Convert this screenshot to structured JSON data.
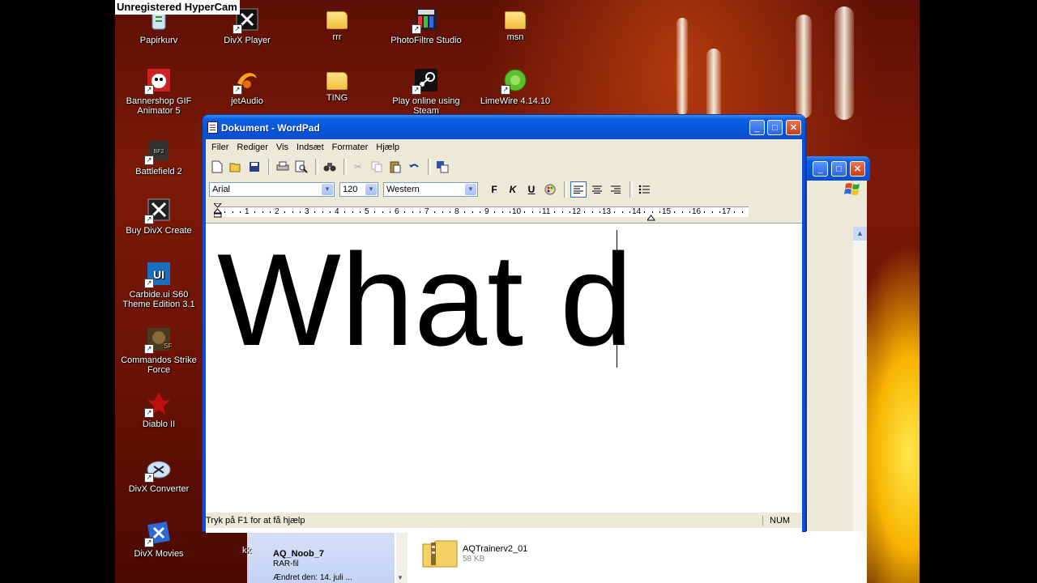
{
  "recorder_banner": "Unregistered HyperCam",
  "desktop": {
    "icons": [
      {
        "label": "Papirkurv",
        "icon": "recycle-bin-icon"
      },
      {
        "label": "DivX Player",
        "icon": "divx-player-icon"
      },
      {
        "label": "rrr",
        "icon": "folder-icon"
      },
      {
        "label": "PhotoFiltre Studio",
        "icon": "photofiltre-icon"
      },
      {
        "label": "msn",
        "icon": "folder-icon"
      },
      {
        "label": "Bannershop GIF Animator 5",
        "icon": "bannershop-icon"
      },
      {
        "label": "jetAudio",
        "icon": "jetaudio-icon"
      },
      {
        "label": "TING",
        "icon": "folder-icon"
      },
      {
        "label": "Play online using Steam",
        "icon": "steam-icon"
      },
      {
        "label": "LimeWire 4.14.10",
        "icon": "limewire-icon"
      },
      {
        "label": "Battlefield 2",
        "icon": "battlefield-icon"
      },
      {
        "label": "Buy DivX Create",
        "icon": "divx-create-icon"
      },
      {
        "label": "Carbide.ui S60 Theme Edition 3.1",
        "icon": "carbide-icon"
      },
      {
        "label": "Commandos Strike Force",
        "icon": "commandos-icon"
      },
      {
        "label": "Diablo II",
        "icon": "diablo-icon"
      },
      {
        "label": "DivX Converter",
        "icon": "divx-converter-icon"
      },
      {
        "label": "DivX Movies",
        "icon": "divx-movies-icon"
      }
    ]
  },
  "wordpad": {
    "title": "Dokument - WordPad",
    "menu": [
      "Filer",
      "Rediger",
      "Vis",
      "Indsæt",
      "Formater",
      "Hjælp"
    ],
    "font_name": "Arial",
    "font_size": "120",
    "script": "Western",
    "format_buttons": {
      "bold": "F",
      "italic": "K",
      "underline": "U"
    },
    "ruler_numbers": [
      "1",
      "2",
      "3",
      "4",
      "5",
      "6",
      "7",
      "8",
      "9",
      "10",
      "11",
      "12",
      "13",
      "14",
      "15",
      "16",
      "17"
    ],
    "document_text": "What d",
    "status_text": "Tryk på F1 for at få hjælp",
    "status_num": "NUM"
  },
  "explorer": {
    "selected_file": {
      "name": "AQ_Noob_7",
      "type": "RAR-fil",
      "modified": "Ændret den: 14. juli ..."
    },
    "file": {
      "name": "AQTrainerv2_01",
      "size": "58 KB"
    },
    "partial_label": "kk"
  }
}
